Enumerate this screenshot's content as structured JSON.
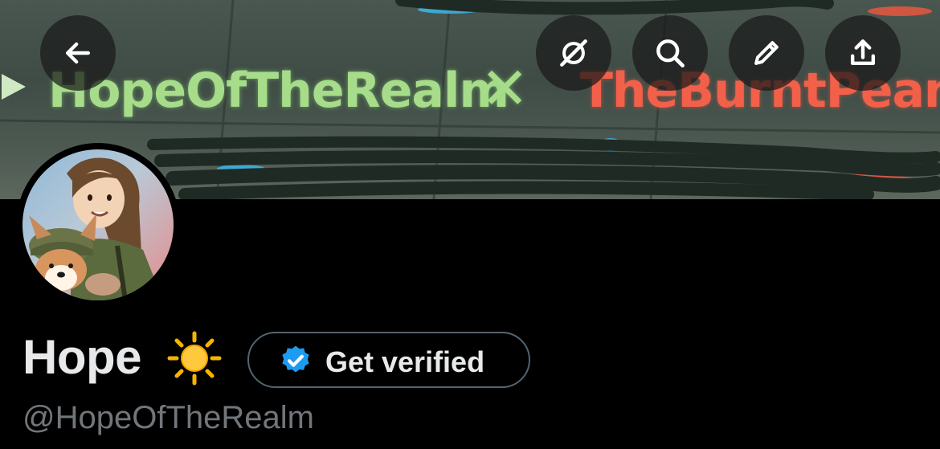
{
  "banner": {
    "left_text": "HopeOfTheRealm",
    "x_text": "✕",
    "right_text": "TheBurntPeanut"
  },
  "toolbar": {
    "back_icon": "arrow-left-icon",
    "grok_icon": "grok-icon",
    "search_icon": "search-icon",
    "edit_icon": "pencil-icon",
    "share_icon": "share-upload-icon"
  },
  "profile": {
    "name": "Hope",
    "emoji_icon": "sun-emoji-icon",
    "handle": "@HopeOfTheRealm",
    "verify_label": "Get verified",
    "verify_badge_color": "#1d9bf0"
  }
}
